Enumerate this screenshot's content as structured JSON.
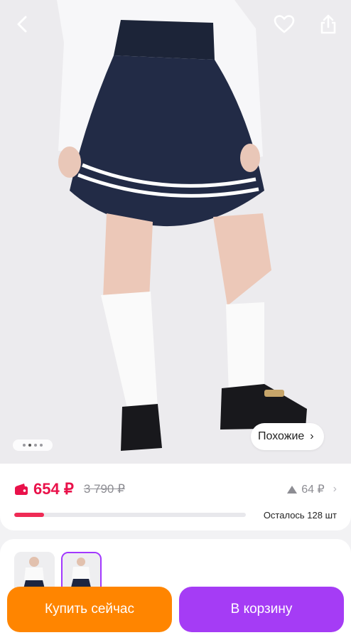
{
  "product": {
    "price": "654 ₽",
    "old_price": "3 790 ₽",
    "rating_count": "64 ₽",
    "stock_text": "Осталось 128 шт",
    "stock_fill_fraction": 0.13
  },
  "gallery": {
    "similar_label": "Похожие",
    "image_count": 4,
    "current_index": 2
  },
  "actions": {
    "buy_now": "Купить сейчас",
    "add_to_cart": "В корзину"
  },
  "colors": {
    "price": "#e9114a",
    "buy_button": "#ff8500",
    "cart_button": "#a53cf5",
    "stock_bar": "#ef2b55"
  },
  "icons": [
    "back-icon",
    "heart-icon",
    "share-icon",
    "wallet-icon",
    "chevron-right-icon",
    "triangle-up-icon"
  ]
}
